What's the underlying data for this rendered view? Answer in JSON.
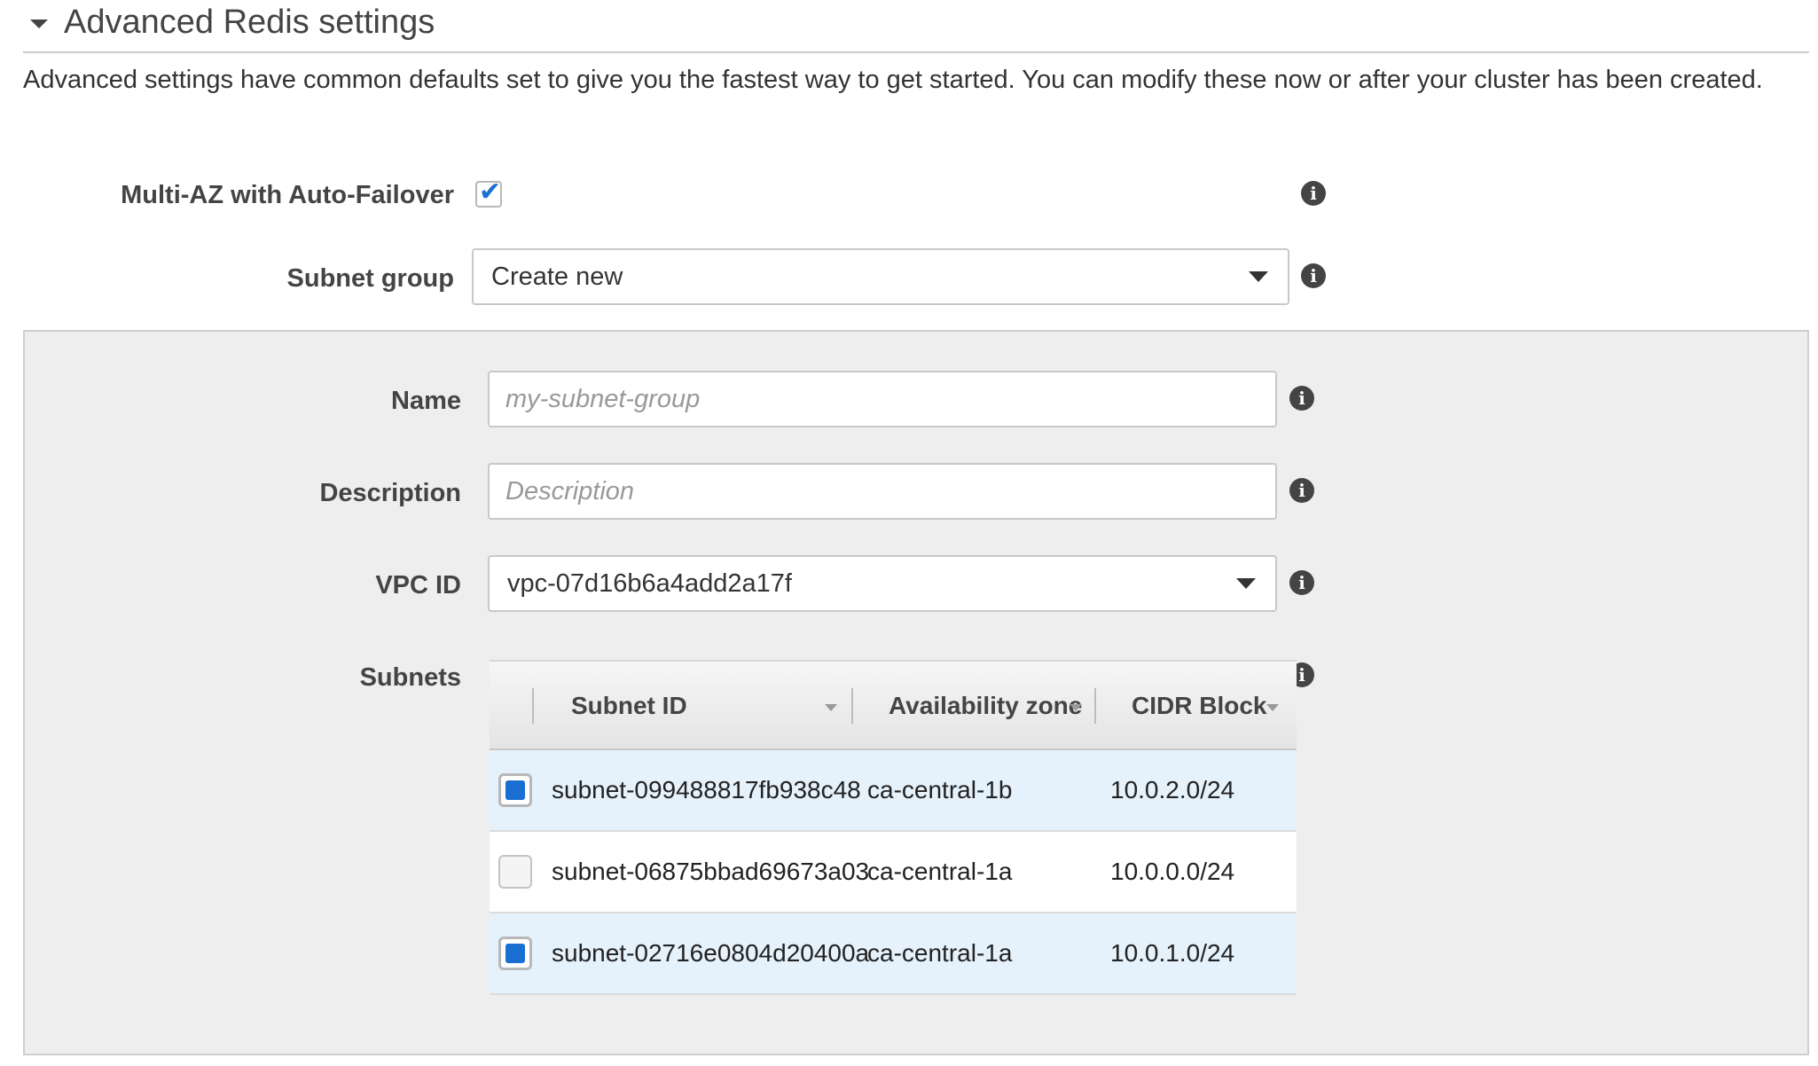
{
  "section": {
    "title": "Advanced Redis settings",
    "description": "Advanced settings have common defaults set to give you the fastest way to get started. You can modify these now or after your cluster has been created."
  },
  "multi_az": {
    "label": "Multi-AZ with Auto-Failover",
    "checked": true
  },
  "subnet_group": {
    "label": "Subnet group",
    "value": "Create new"
  },
  "panel": {
    "name": {
      "label": "Name",
      "placeholder": "my-subnet-group"
    },
    "description": {
      "label": "Description",
      "placeholder": "Description"
    },
    "vpc": {
      "label": "VPC ID",
      "value": "vpc-07d16b6a4add2a17f"
    },
    "subnets": {
      "label": "Subnets",
      "columns": [
        "Subnet ID",
        "Availability zone",
        "CIDR Block"
      ],
      "rows": [
        {
          "id": "subnet-099488817fb938c48",
          "zone": "ca-central-1b",
          "cidr": "10.0.2.0/24",
          "selected": true
        },
        {
          "id": "subnet-06875bbad69673a03",
          "zone": "ca-central-1a",
          "cidr": "10.0.0.0/24",
          "selected": false
        },
        {
          "id": "subnet-02716e0804d20400a",
          "zone": "ca-central-1a",
          "cidr": "10.0.1.0/24",
          "selected": true
        }
      ]
    }
  },
  "icons": {
    "collapse": "caret-down-icon",
    "info": "info-icon",
    "check": "checkmark-icon",
    "dropdown": "dropdown-arrow-icon",
    "sort": "sort-caret-icon"
  },
  "colors": {
    "accent": "#1a6fd3",
    "selected_row": "#e5f1fb",
    "panel_bg": "#eeeeee"
  }
}
